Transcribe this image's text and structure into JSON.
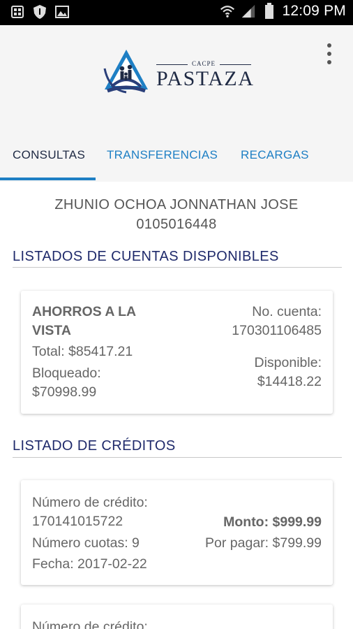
{
  "status_bar": {
    "time": "12:09 PM",
    "icons_left": [
      "sim-manager-icon",
      "shield-icon",
      "image-icon"
    ],
    "icons_right": [
      "wifi-icon",
      "signal-icon",
      "battery-icon"
    ]
  },
  "header": {
    "logo_small": "CACPE",
    "logo_big": "PASTAZA"
  },
  "tabs": [
    {
      "label": "CONSULTAS",
      "active": true
    },
    {
      "label": "TRANSFERENCIAS",
      "active": false
    },
    {
      "label": "RECARGAS",
      "active": false
    }
  ],
  "user": {
    "name": "ZHUNIO OCHOA JONNATHAN JOSE",
    "id": "0105016448"
  },
  "accounts_section": {
    "title": "LISTADOS DE CUENTAS DISPONIBLES",
    "items": [
      {
        "type_line1": "AHORROS A LA",
        "type_line2": "VISTA",
        "total": "Total: $85417.21",
        "blocked_label": "Bloqueado:",
        "blocked_value": "$70998.99",
        "account_label": "No. cuenta:",
        "account_number": "170301106485",
        "available_label": "Disponible:",
        "available_value": "$14418.22"
      }
    ]
  },
  "credits_section": {
    "title": "LISTADO DE CRÉDITOS",
    "items": [
      {
        "number_label": "Número de crédito:",
        "number": "170141015722",
        "installments": "Número cuotas: 9",
        "date": "Fecha: 2017-02-22",
        "amount": "Monto: $999.99",
        "pending": "Por pagar: $799.99"
      },
      {
        "number_label": "Número de crédito:"
      }
    ]
  },
  "colors": {
    "accent": "#1e7fc4",
    "title_navy": "#1f2a6b",
    "header_bg": "#f5f5f5"
  }
}
